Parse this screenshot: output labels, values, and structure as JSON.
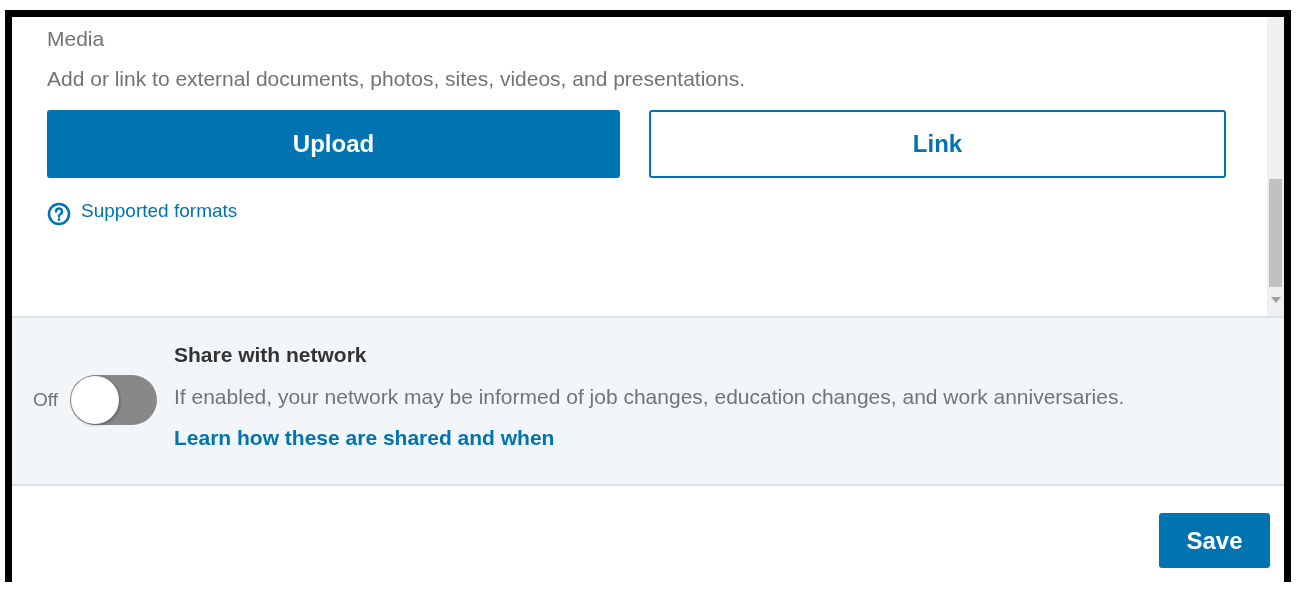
{
  "media": {
    "title": "Media",
    "description": "Add or link to external documents, photos, sites, videos, and presentations.",
    "buttons": [
      {
        "label": "Upload",
        "kind": "primary"
      },
      {
        "label": "Link",
        "kind": "secondary"
      }
    ],
    "help_link": "Supported formats"
  },
  "share": {
    "state_label": "Off",
    "on": false,
    "title": "Share with network",
    "description": "If enabled, your network may be informed of job changes, education changes, and work anniversaries.",
    "link": "Learn how these are shared and when"
  },
  "save_button": "Save"
}
